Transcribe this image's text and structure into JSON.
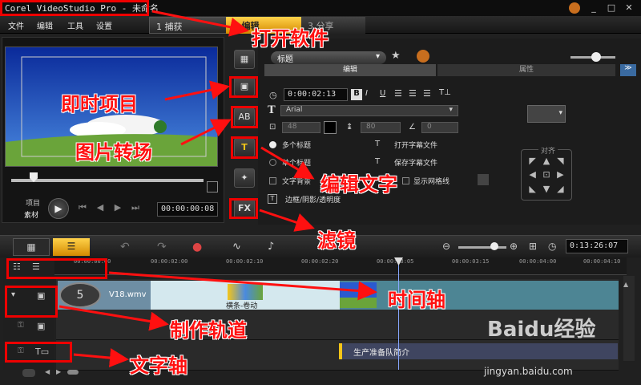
{
  "window": {
    "title": "Corel VideoStudio Pro - 未命名"
  },
  "menu": [
    "文件",
    "编辑",
    "工具",
    "设置"
  ],
  "steps": {
    "capture": "1 捕获",
    "edit": "2 编辑",
    "share": "3 分享"
  },
  "preview": {
    "mode_project": "项目",
    "mode_clip": "素材",
    "timecode": "00:00:00:08"
  },
  "library_tools": [
    "media-icon",
    "instant-project-icon",
    "transition-icon",
    "title-icon",
    "graphic-icon",
    "filter-icon"
  ],
  "options": {
    "category": "标题",
    "tab_edit": "编辑",
    "tab_attributes": "属性",
    "duration": "0:00:02:13",
    "font": "Arial",
    "font_size": "48",
    "line_spacing": "80",
    "rotation": "0",
    "multi_title": "多个标题",
    "single_title": "单个标题",
    "open_subtitle": "打开字幕文件",
    "save_subtitle": "保存字幕文件",
    "text_background": "文字背景",
    "show_grid": "显示网格线",
    "border_shadow": "边框/阴影/透明度",
    "align_label": "对齐"
  },
  "timeline": {
    "project_timecode": "0:13:26:07",
    "ticks": [
      "00:00:00:00",
      "00:00:02:00",
      "00:00:02:10",
      "00:00:02:20",
      "00:00:03:05",
      "00:00:03:15",
      "00:00:04:00",
      "00:00:04:10"
    ],
    "clip_video_name": "V18.wmv",
    "transition_name": "横条-卷动",
    "title_clip_text": "生产准备队简介"
  },
  "annotations": {
    "open_software": "打开软件",
    "instant_project": "即时项目",
    "transition": "图片转场",
    "edit_text": "编辑文字",
    "filter": "滤镜",
    "timeline_axis": "时间轴",
    "production_track": "制作轨道",
    "text_axis": "文字轴"
  },
  "watermark": {
    "brand": "Baidu经验",
    "url": "jingyan.baidu.com"
  },
  "colors": {
    "accent": "#f5c518",
    "annotation": "#ff1010",
    "playhead": "#88a8ff"
  }
}
